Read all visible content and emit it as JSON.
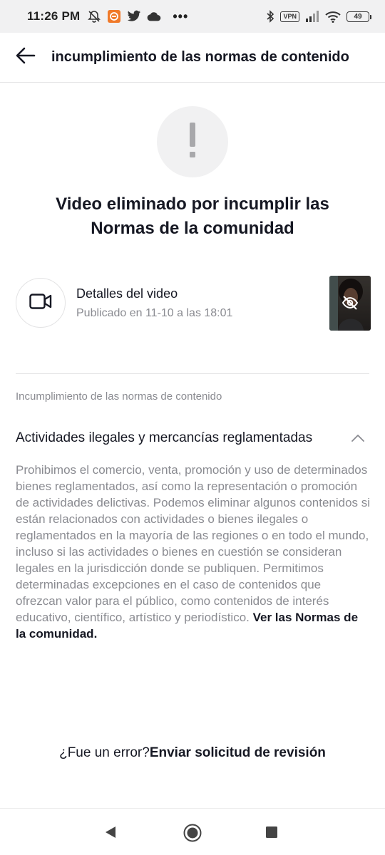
{
  "status_bar": {
    "time": "11:26 PM",
    "vpn_label": "VPN",
    "battery_level": "49",
    "more_indicator": "•••",
    "icons": [
      "alarm-off-icon",
      "app-notification-icon",
      "twitter-icon",
      "cloud-icon",
      "bluetooth-icon",
      "vpn-icon",
      "signal-icon",
      "wifi-icon",
      "battery-icon"
    ]
  },
  "header": {
    "back_icon": "arrow-left-icon",
    "title": "incumplimiento de las normas de contenido"
  },
  "alert": {
    "icon": "exclamation-icon",
    "title": "Video eliminado por incumplir las Normas de la comunidad"
  },
  "video_details": {
    "icon": "video-camera-icon",
    "label": "Detalles del video",
    "published": "Publicado en 11-10 a las 18:01",
    "thumbnail_overlay_icon": "eye-off-icon"
  },
  "violation": {
    "section_label": "Incumplimiento de las normas de contenido",
    "category_title": "Actividades ilegales y mercancías reglamentadas",
    "expanded": true,
    "description": "Prohibimos el comercio, venta, promoción y uso de determinados bienes reglamentados, así como la representación o promoción de actividades delictivas. Podemos eliminar algunos contenidos si están relacionados con actividades o bienes ilegales o reglamentados en la mayoría de las regiones o en todo el mundo, incluso si las actividades o bienes en cuestión se consideran legales en la jurisdicción donde se publiquen. Permitimos determinadas excepciones en el caso de contenidos que ofrezcan valor para el público, como contenidos de interés educativo, científico, artístico y periodístico.",
    "guidelines_link": "Ver las Normas de la comunidad."
  },
  "appeal": {
    "question": "¿Fue un error?",
    "link": "Enviar solicitud de revisión"
  },
  "nav_bar": {
    "buttons": [
      "back-triangle-icon",
      "home-circle-icon",
      "recents-square-icon"
    ]
  },
  "colors": {
    "text_primary": "#161823",
    "text_secondary": "#8a8b91",
    "circle_bg": "#f1f1f2",
    "divider": "#e3e3e4",
    "status_bar_bg": "#f1f1f2"
  }
}
